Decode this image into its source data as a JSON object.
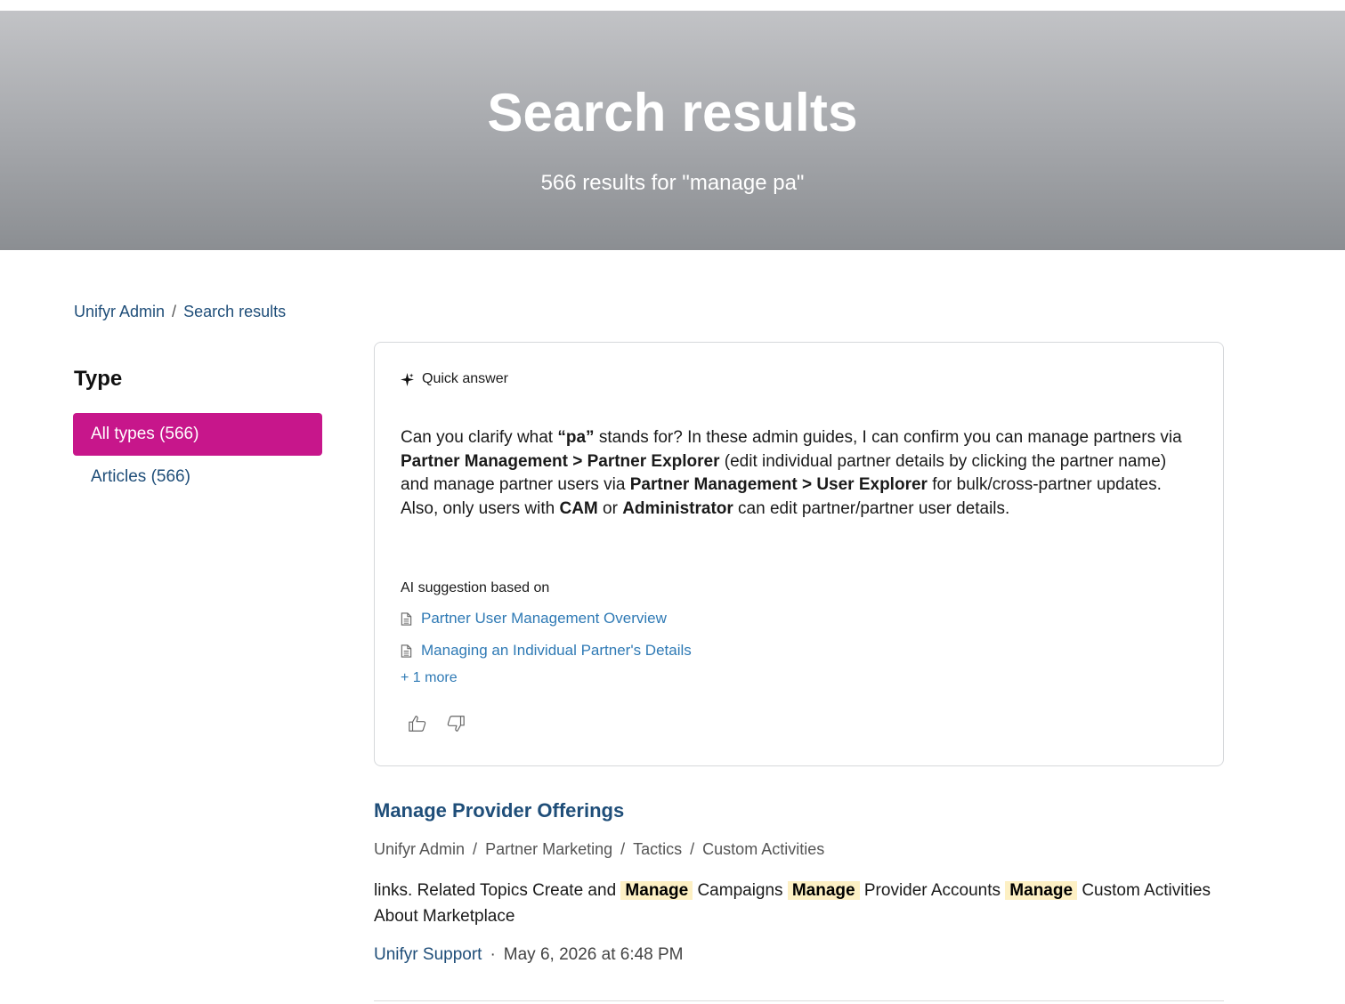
{
  "hero": {
    "title": "Search results",
    "subtitle": "566 results for \"manage pa\""
  },
  "breadcrumb": [
    "Unifyr Admin",
    "Search results"
  ],
  "sidebar": {
    "heading": "Type",
    "items": [
      {
        "label": "All types (566)",
        "active": true
      },
      {
        "label": "Articles (566)",
        "active": false
      }
    ]
  },
  "quick_answer": {
    "header": "Quick answer",
    "body": [
      {
        "t": "Can you clarify what "
      },
      {
        "t": "“pa”",
        "b": true
      },
      {
        "t": " stands for? In these admin guides, I can confirm you can manage partners via "
      },
      {
        "t": "Partner Management > Partner Explorer",
        "b": true
      },
      {
        "t": " (edit individual partner details by clicking the partner name) and manage partner users via "
      },
      {
        "t": "Partner Management > User Explorer",
        "b": true
      },
      {
        "t": " for bulk/cross-partner updates. Also, only users with "
      },
      {
        "t": "CAM",
        "b": true
      },
      {
        "t": " or "
      },
      {
        "t": "Administrator",
        "b": true
      },
      {
        "t": " can edit partner/partner user details."
      }
    ],
    "suggestion_label": "AI suggestion based on",
    "sources": [
      "Partner User Management Overview",
      "Managing an Individual Partner's Details"
    ],
    "more_label": "+ 1 more"
  },
  "result": {
    "title": "Manage Provider Offerings",
    "crumbs": [
      "Unifyr Admin",
      "Partner Marketing",
      "Tactics",
      "Custom Activities"
    ],
    "snippet": [
      {
        "t": "links. Related Topics Create and "
      },
      {
        "t": "Manage",
        "hl": true
      },
      {
        "t": " Campaigns "
      },
      {
        "t": "Manage",
        "hl": true
      },
      {
        "t": " Provider Accounts "
      },
      {
        "t": "Manage",
        "hl": true
      },
      {
        "t": " Custom Activities About Marketplace"
      }
    ],
    "author": "Unifyr Support",
    "separator": "·",
    "date": "May 6, 2026 at 6:48 PM"
  },
  "colors": {
    "accent": "#c7168b",
    "link": "#1f4e79",
    "source_link": "#2f7ab5",
    "highlight": "#fdf0c4"
  },
  "icons": {
    "quick_answer": "sparkle-icon",
    "source": "document-icon",
    "like": "thumbs-up-icon",
    "dislike": "thumbs-down-icon"
  }
}
